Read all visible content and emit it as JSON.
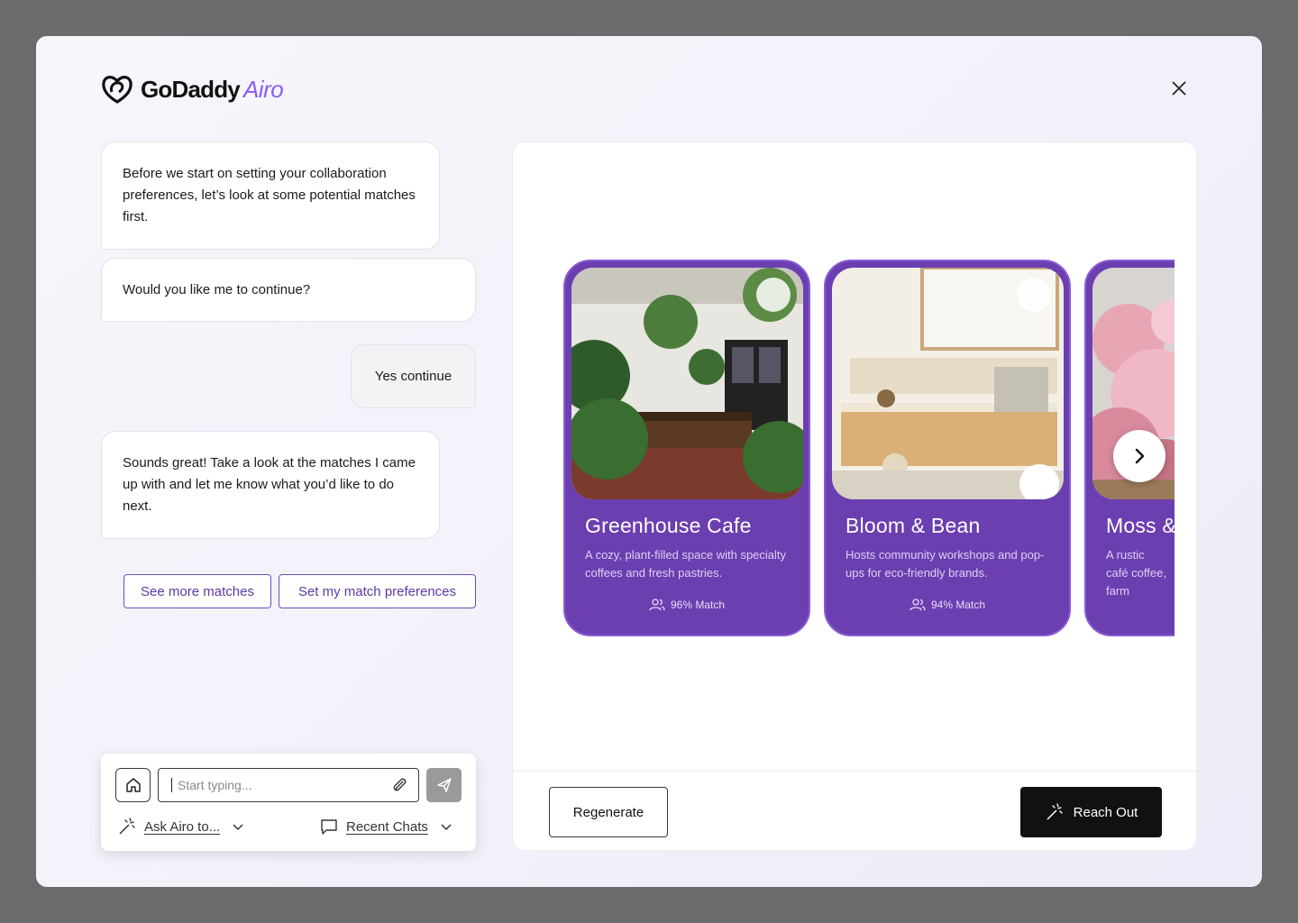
{
  "brand": {
    "name": "GoDaddy",
    "product": "Airo"
  },
  "chat": {
    "messages": [
      {
        "from": "assistant",
        "text": "Before we start on setting your collaboration preferences, let’s look at some potential matches first."
      },
      {
        "from": "assistant",
        "text": "Would you like me to continue?"
      },
      {
        "from": "user",
        "text": "Yes continue"
      },
      {
        "from": "assistant",
        "text": "Sounds great! Take a look at the matches I came up with and let me know what you’d like to do next."
      }
    ],
    "chips": [
      "See more matches",
      "Set my match preferences"
    ]
  },
  "composer": {
    "placeholder": "Start typing...",
    "ask_label": "Ask Airo to...",
    "recent_label": "Recent Chats"
  },
  "matches": [
    {
      "name": "Greenhouse Cafe",
      "description": "A cozy, plant-filled space with specialty coffees and fresh pastries.",
      "match": "96% Match"
    },
    {
      "name": "Bloom & Bean",
      "description": "Hosts community workshops and pop-ups for eco-friendly brands.",
      "match": "94% Match"
    },
    {
      "name": "Moss & ",
      "description": "A rustic café coffee, farm",
      "match": ""
    }
  ],
  "panel": {
    "regenerate_label": "Regenerate",
    "reach_out_label": "Reach Out"
  },
  "colors": {
    "accent": "#6b3fb0",
    "chip_text": "#5b3aa8",
    "primary_button": "#111111"
  }
}
